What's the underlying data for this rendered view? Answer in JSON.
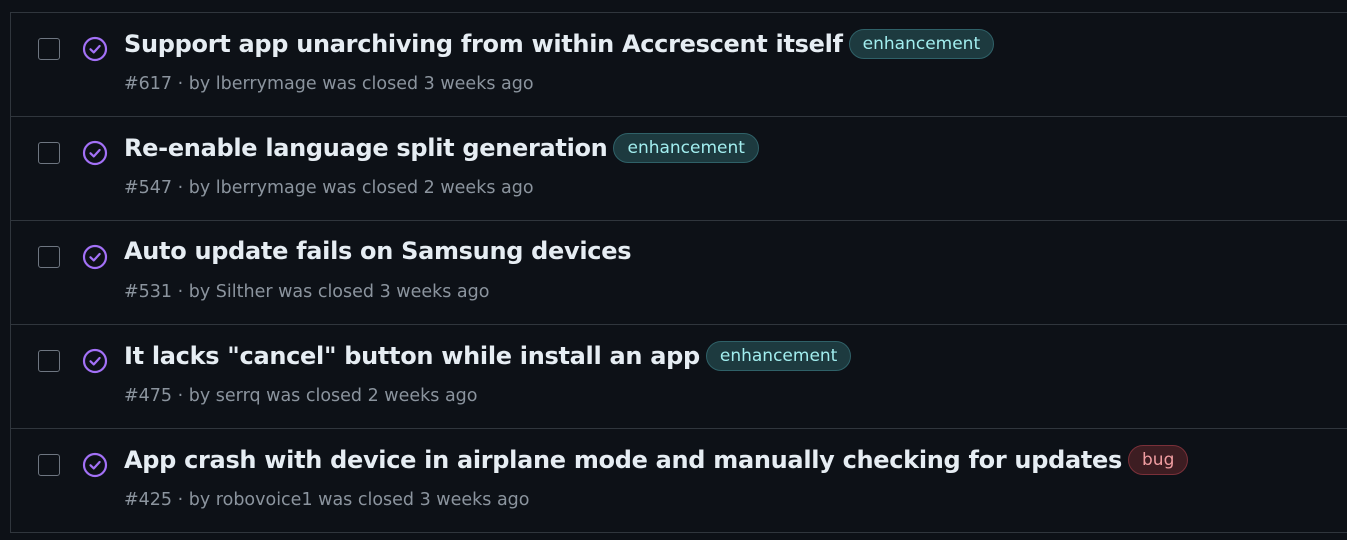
{
  "colors": {
    "background": "#0d1117",
    "border": "#30363d",
    "closed_icon": "#a371f7",
    "enhancement_bg": "#1d3a3f",
    "enhancement_text": "#a2eeef",
    "bug_bg": "#3d1d22",
    "bug_text": "#f09da1"
  },
  "issues": [
    {
      "title": "Support app unarchiving from within Accrescent itself",
      "label": "enhancement",
      "number": "#617",
      "sep": " · by ",
      "author": "lberrymage",
      "status": " was closed 3 weeks ago",
      "icon": "closed-check-circle-icon"
    },
    {
      "title": "Re-enable language split generation",
      "label": "enhancement",
      "number": "#547",
      "sep": " · by ",
      "author": "lberrymage",
      "status": " was closed 2 weeks ago",
      "icon": "closed-check-circle-icon"
    },
    {
      "title": "Auto update fails on Samsung devices",
      "label": "",
      "number": "#531",
      "sep": " · by ",
      "author": "Silther",
      "status": " was closed 3 weeks ago",
      "icon": "closed-check-circle-icon"
    },
    {
      "title": "It lacks \"cancel\" button while install an app",
      "label": "enhancement",
      "number": "#475",
      "sep": " · by ",
      "author": "serrq",
      "status": " was closed 2 weeks ago",
      "icon": "closed-check-circle-icon"
    },
    {
      "title": "App crash with device in airplane mode and manually checking for updates",
      "label": "bug",
      "number": "#425",
      "sep": " · by ",
      "author": "robovoice1",
      "status": " was closed 3 weeks ago",
      "icon": "closed-check-circle-icon"
    }
  ]
}
